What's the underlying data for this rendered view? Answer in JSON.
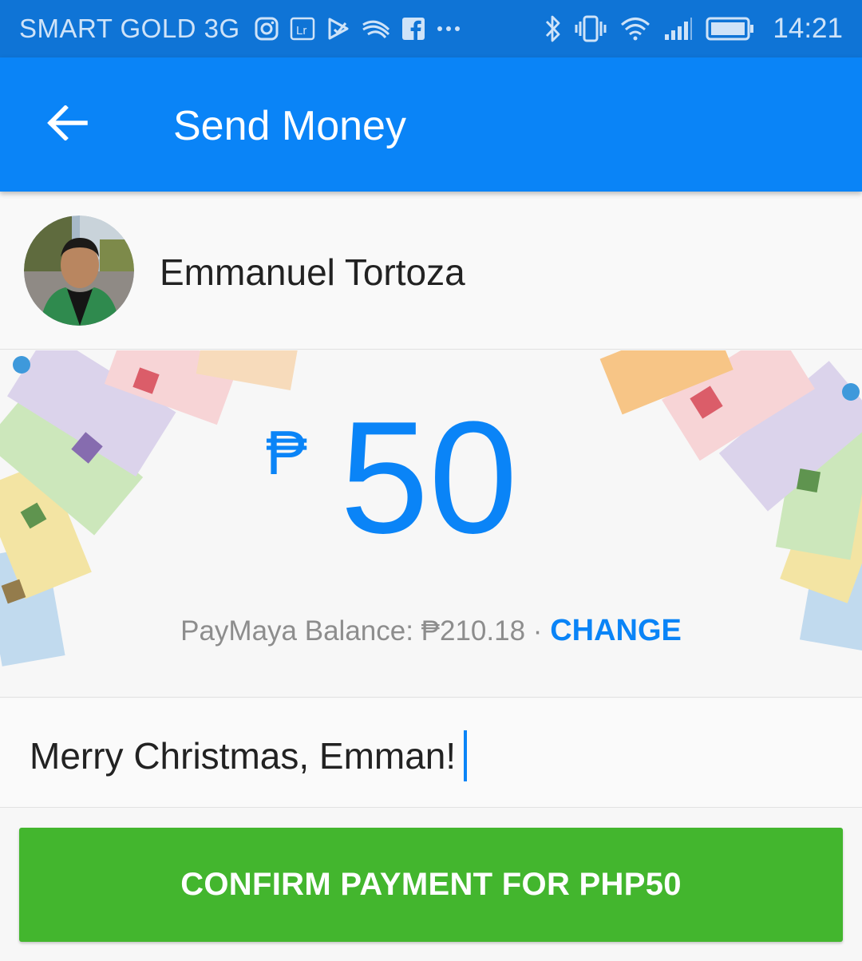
{
  "status_bar": {
    "carrier": "SMART GOLD 3G",
    "time": "14:21",
    "icons": [
      "instagram-icon",
      "lightroom-icon",
      "play-store-icon",
      "swiftkey-icon",
      "facebook-icon",
      "more-dots-icon",
      "bluetooth-icon",
      "vibrate-icon",
      "wifi-icon",
      "signal-icon",
      "battery-icon"
    ],
    "background": "#0f74d6"
  },
  "app_bar": {
    "title": "Send Money",
    "back_icon": "back-arrow-icon",
    "background": "#0a84f7"
  },
  "recipient": {
    "name": "Emmanuel Tortoza"
  },
  "amount": {
    "currency_symbol": "₱",
    "value": "50",
    "balance_label": "PayMaya Balance: ₱210.18",
    "separator": "·",
    "change_label": "CHANGE",
    "accent": "#0a84f7"
  },
  "message": {
    "value": "Merry Christmas, Emman!"
  },
  "confirm": {
    "label": "CONFIRM PAYMENT FOR PHP50",
    "color": "#43b62e"
  }
}
